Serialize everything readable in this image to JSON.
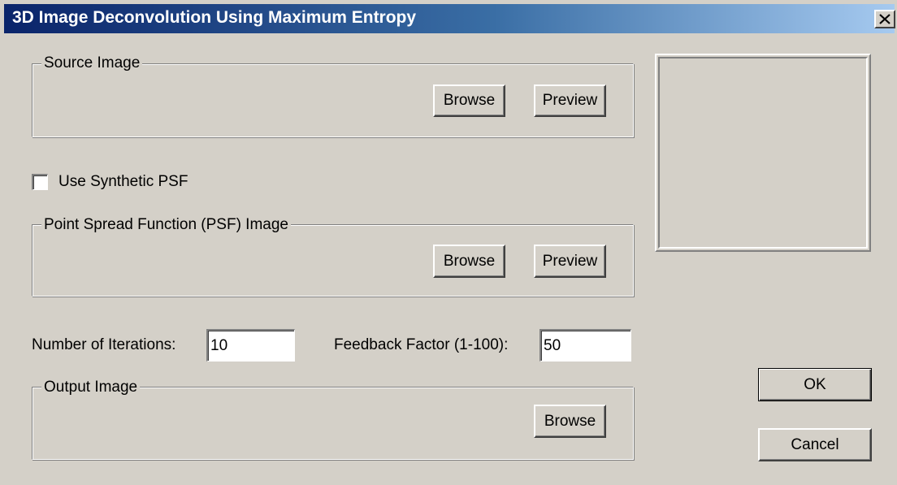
{
  "window": {
    "title": "3D Image Deconvolution Using Maximum Entropy",
    "close_icon": "close-icon"
  },
  "source_image": {
    "group_label": "Source Image",
    "browse_label": "Browse",
    "preview_label": "Preview"
  },
  "synthetic_psf": {
    "label": "Use Synthetic PSF",
    "checked": false
  },
  "psf_image": {
    "group_label": "Point Spread Function (PSF) Image",
    "browse_label": "Browse",
    "preview_label": "Preview"
  },
  "parameters": {
    "iterations_label": "Number of Iterations:",
    "iterations_value": "10",
    "feedback_label": "Feedback Factor (1-100):",
    "feedback_value": "50"
  },
  "output_image": {
    "group_label": "Output Image",
    "browse_label": "Browse"
  },
  "actions": {
    "ok_label": "OK",
    "cancel_label": "Cancel"
  },
  "colors": {
    "dialog_face": "#d4d0c8",
    "title_start": "#0a246a",
    "title_end": "#a6caf0"
  }
}
